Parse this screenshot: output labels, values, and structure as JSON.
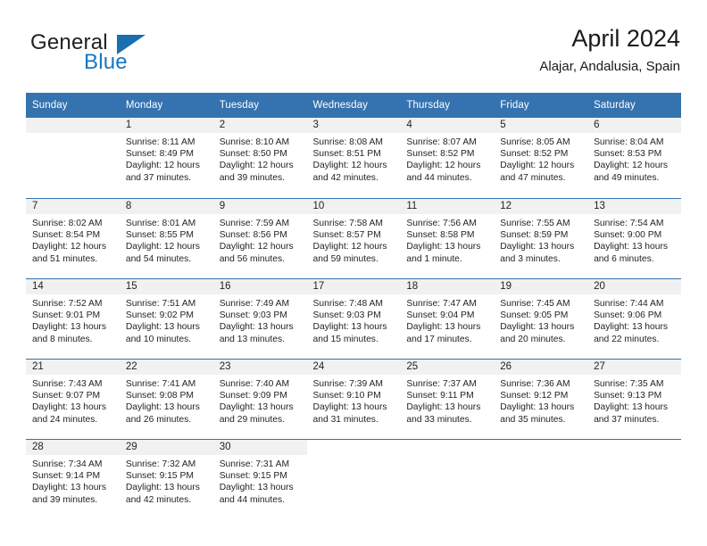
{
  "brand": {
    "name_part1": "General",
    "name_part2": "Blue",
    "logo_icon": "triangle-logo-icon",
    "accent_color": "#1877c0"
  },
  "header": {
    "title": "April 2024",
    "location": "Alajar, Andalusia, Spain"
  },
  "calendar": {
    "header_bg_color": "#3572b0",
    "daynum_band_color": "#f1f1f1",
    "weekday_headers": [
      "Sunday",
      "Monday",
      "Tuesday",
      "Wednesday",
      "Thursday",
      "Friday",
      "Saturday"
    ],
    "weeks": [
      [
        {
          "day": "",
          "lines": []
        },
        {
          "day": "1",
          "lines": [
            "Sunrise: 8:11 AM",
            "Sunset: 8:49 PM",
            "Daylight: 12 hours",
            "and 37 minutes."
          ]
        },
        {
          "day": "2",
          "lines": [
            "Sunrise: 8:10 AM",
            "Sunset: 8:50 PM",
            "Daylight: 12 hours",
            "and 39 minutes."
          ]
        },
        {
          "day": "3",
          "lines": [
            "Sunrise: 8:08 AM",
            "Sunset: 8:51 PM",
            "Daylight: 12 hours",
            "and 42 minutes."
          ]
        },
        {
          "day": "4",
          "lines": [
            "Sunrise: 8:07 AM",
            "Sunset: 8:52 PM",
            "Daylight: 12 hours",
            "and 44 minutes."
          ]
        },
        {
          "day": "5",
          "lines": [
            "Sunrise: 8:05 AM",
            "Sunset: 8:52 PM",
            "Daylight: 12 hours",
            "and 47 minutes."
          ]
        },
        {
          "day": "6",
          "lines": [
            "Sunrise: 8:04 AM",
            "Sunset: 8:53 PM",
            "Daylight: 12 hours",
            "and 49 minutes."
          ]
        }
      ],
      [
        {
          "day": "7",
          "lines": [
            "Sunrise: 8:02 AM",
            "Sunset: 8:54 PM",
            "Daylight: 12 hours",
            "and 51 minutes."
          ]
        },
        {
          "day": "8",
          "lines": [
            "Sunrise: 8:01 AM",
            "Sunset: 8:55 PM",
            "Daylight: 12 hours",
            "and 54 minutes."
          ]
        },
        {
          "day": "9",
          "lines": [
            "Sunrise: 7:59 AM",
            "Sunset: 8:56 PM",
            "Daylight: 12 hours",
            "and 56 minutes."
          ]
        },
        {
          "day": "10",
          "lines": [
            "Sunrise: 7:58 AM",
            "Sunset: 8:57 PM",
            "Daylight: 12 hours",
            "and 59 minutes."
          ]
        },
        {
          "day": "11",
          "lines": [
            "Sunrise: 7:56 AM",
            "Sunset: 8:58 PM",
            "Daylight: 13 hours",
            "and 1 minute."
          ]
        },
        {
          "day": "12",
          "lines": [
            "Sunrise: 7:55 AM",
            "Sunset: 8:59 PM",
            "Daylight: 13 hours",
            "and 3 minutes."
          ]
        },
        {
          "day": "13",
          "lines": [
            "Sunrise: 7:54 AM",
            "Sunset: 9:00 PM",
            "Daylight: 13 hours",
            "and 6 minutes."
          ]
        }
      ],
      [
        {
          "day": "14",
          "lines": [
            "Sunrise: 7:52 AM",
            "Sunset: 9:01 PM",
            "Daylight: 13 hours",
            "and 8 minutes."
          ]
        },
        {
          "day": "15",
          "lines": [
            "Sunrise: 7:51 AM",
            "Sunset: 9:02 PM",
            "Daylight: 13 hours",
            "and 10 minutes."
          ]
        },
        {
          "day": "16",
          "lines": [
            "Sunrise: 7:49 AM",
            "Sunset: 9:03 PM",
            "Daylight: 13 hours",
            "and 13 minutes."
          ]
        },
        {
          "day": "17",
          "lines": [
            "Sunrise: 7:48 AM",
            "Sunset: 9:03 PM",
            "Daylight: 13 hours",
            "and 15 minutes."
          ]
        },
        {
          "day": "18",
          "lines": [
            "Sunrise: 7:47 AM",
            "Sunset: 9:04 PM",
            "Daylight: 13 hours",
            "and 17 minutes."
          ]
        },
        {
          "day": "19",
          "lines": [
            "Sunrise: 7:45 AM",
            "Sunset: 9:05 PM",
            "Daylight: 13 hours",
            "and 20 minutes."
          ]
        },
        {
          "day": "20",
          "lines": [
            "Sunrise: 7:44 AM",
            "Sunset: 9:06 PM",
            "Daylight: 13 hours",
            "and 22 minutes."
          ]
        }
      ],
      [
        {
          "day": "21",
          "lines": [
            "Sunrise: 7:43 AM",
            "Sunset: 9:07 PM",
            "Daylight: 13 hours",
            "and 24 minutes."
          ]
        },
        {
          "day": "22",
          "lines": [
            "Sunrise: 7:41 AM",
            "Sunset: 9:08 PM",
            "Daylight: 13 hours",
            "and 26 minutes."
          ]
        },
        {
          "day": "23",
          "lines": [
            "Sunrise: 7:40 AM",
            "Sunset: 9:09 PM",
            "Daylight: 13 hours",
            "and 29 minutes."
          ]
        },
        {
          "day": "24",
          "lines": [
            "Sunrise: 7:39 AM",
            "Sunset: 9:10 PM",
            "Daylight: 13 hours",
            "and 31 minutes."
          ]
        },
        {
          "day": "25",
          "lines": [
            "Sunrise: 7:37 AM",
            "Sunset: 9:11 PM",
            "Daylight: 13 hours",
            "and 33 minutes."
          ]
        },
        {
          "day": "26",
          "lines": [
            "Sunrise: 7:36 AM",
            "Sunset: 9:12 PM",
            "Daylight: 13 hours",
            "and 35 minutes."
          ]
        },
        {
          "day": "27",
          "lines": [
            "Sunrise: 7:35 AM",
            "Sunset: 9:13 PM",
            "Daylight: 13 hours",
            "and 37 minutes."
          ]
        }
      ],
      [
        {
          "day": "28",
          "lines": [
            "Sunrise: 7:34 AM",
            "Sunset: 9:14 PM",
            "Daylight: 13 hours",
            "and 39 minutes."
          ]
        },
        {
          "day": "29",
          "lines": [
            "Sunrise: 7:32 AM",
            "Sunset: 9:15 PM",
            "Daylight: 13 hours",
            "and 42 minutes."
          ]
        },
        {
          "day": "30",
          "lines": [
            "Sunrise: 7:31 AM",
            "Sunset: 9:15 PM",
            "Daylight: 13 hours",
            "and 44 minutes."
          ]
        },
        {
          "day": "",
          "lines": []
        },
        {
          "day": "",
          "lines": []
        },
        {
          "day": "",
          "lines": []
        },
        {
          "day": "",
          "lines": []
        }
      ]
    ]
  }
}
